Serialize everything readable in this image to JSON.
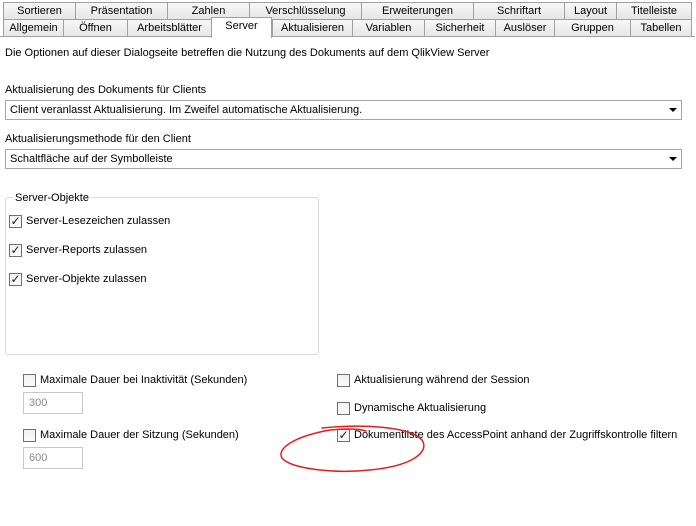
{
  "tabs_row1": [
    "Sortieren",
    "Präsentation",
    "Zahlen",
    "Verschlüsselung",
    "Erweiterungen",
    "Schriftart",
    "Layout",
    "Titelleiste"
  ],
  "tabs_row2": [
    "Allgemein",
    "Öffnen",
    "Arbeitsblätter",
    "Server",
    "Aktualisieren",
    "Variablen",
    "Sicherheit",
    "Auslöser",
    "Gruppen",
    "Tabellen"
  ],
  "active_tab": "Server",
  "intro_text": "Die Optionen auf dieser Dialogseite betreffen die Nutzung des Dokuments auf dem QlikView Server",
  "refresh_clients": {
    "label": "Aktualisierung des Dokuments für Clients",
    "value": "Client veranlasst Aktualisierung. Im Zweifel automatische Aktualisierung."
  },
  "refresh_method": {
    "label": "Aktualisierungsmethode für den Client",
    "value": "Schaltfläche auf der Symbolleiste"
  },
  "server_objects": {
    "title": "Server-Objekte",
    "items": [
      {
        "label": "Server-Lesezeichen zulassen",
        "checked": true
      },
      {
        "label": "Server-Reports zulassen",
        "checked": true
      },
      {
        "label": "Server-Objekte zulassen",
        "checked": true
      }
    ]
  },
  "inactivity": {
    "label": "Maximale Dauer bei Inaktivität (Sekunden)",
    "checked": false,
    "value": "300"
  },
  "session_duration": {
    "label": "Maximale Dauer der Sitzung (Sekunden)",
    "checked": false,
    "value": "600"
  },
  "update_during_session": {
    "label": "Aktualisierung während der Session",
    "checked": false
  },
  "dynamic_update": {
    "label": "Dynamische Aktualisierung",
    "checked": false
  },
  "filter_doclist": {
    "label": "Dokumentliste des AccessPoint anhand der Zugriffskontrolle filtern",
    "checked": true
  },
  "colors": {
    "annotation_circle": "#e02020",
    "border": "#a0a0a0"
  }
}
